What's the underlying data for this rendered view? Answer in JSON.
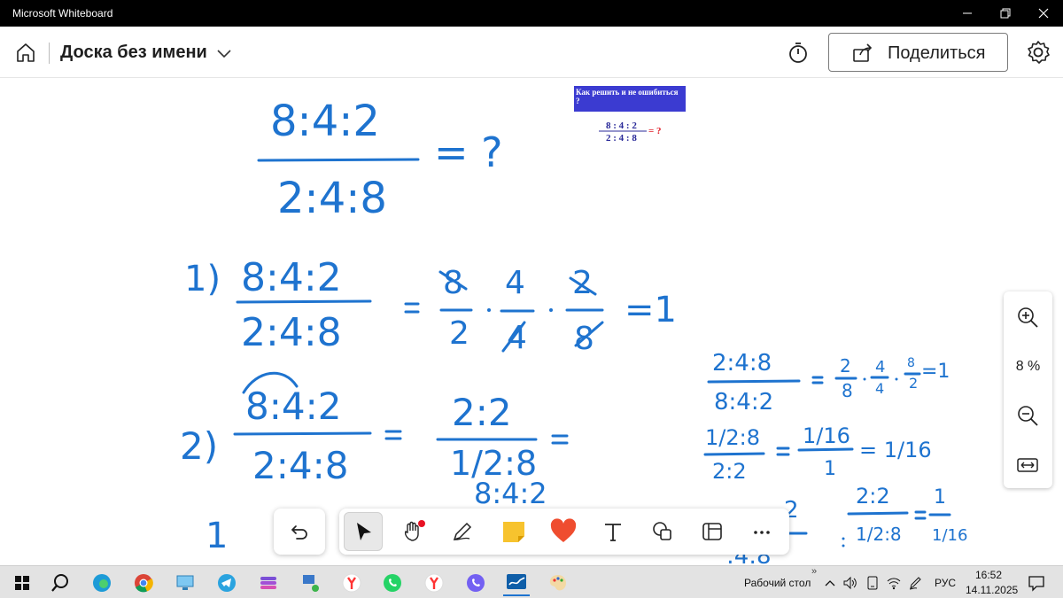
{
  "window": {
    "app_title": "Microsoft Whiteboard"
  },
  "header": {
    "board_title": "Доска без имени",
    "share_label": "Поделиться"
  },
  "card": {
    "question": "Как решить и не ошибиться ?",
    "numerator": "8 : 4 : 2",
    "denominator": "2 : 4 : 8",
    "suffix": "= ?"
  },
  "zoom": {
    "level": "8 %"
  },
  "toolbar": {
    "tools": [
      "undo",
      "select",
      "pan",
      "pen",
      "sticky-note",
      "reactions",
      "text",
      "shapes",
      "templates",
      "more"
    ],
    "active_tool": "select"
  },
  "taskbar": {
    "desktop_label": "Рабочий стол",
    "language": "РУС",
    "time": "16:52",
    "date": "14.11.2025"
  },
  "ink": {
    "top_num": "8:4:2",
    "top_den": "2:4:8",
    "top_rhs": "= ?",
    "s1_label": "1)",
    "s1_num": "8:4:2",
    "s1_den": "2:4:8",
    "s1_result": "=1",
    "s2_label": "2)",
    "s2_num": "8:4:2",
    "s2_den": "2:4:8",
    "s2_mid_num": "2:2",
    "s2_mid_den": "1/2:8",
    "s3_partial": "8:4:2",
    "s3_label": "1",
    "r1_num": "2:4:8",
    "r1_den": "8:4:2",
    "r1_result": "=1",
    "r2_num": "1/2:8",
    "r2_den": "2:2",
    "r2_frac_num": "1/16",
    "r2_frac_den": "1",
    "r2_result": "= 1/16",
    "r3_num": "2:2",
    "r3_den": "1/2:8",
    "r3_res_num": "1",
    "r3_res_den": "1/16",
    "bottom_partial_num": "2",
    "bottom_partial_den": ":4:8"
  },
  "colors": {
    "ink": "#1e73cf",
    "card_bg": "#3b3bd1",
    "card_text": "#ffffff",
    "card_red": "#e0202a",
    "titlebar": "#000000",
    "taskbar": "#e3e3e3"
  }
}
